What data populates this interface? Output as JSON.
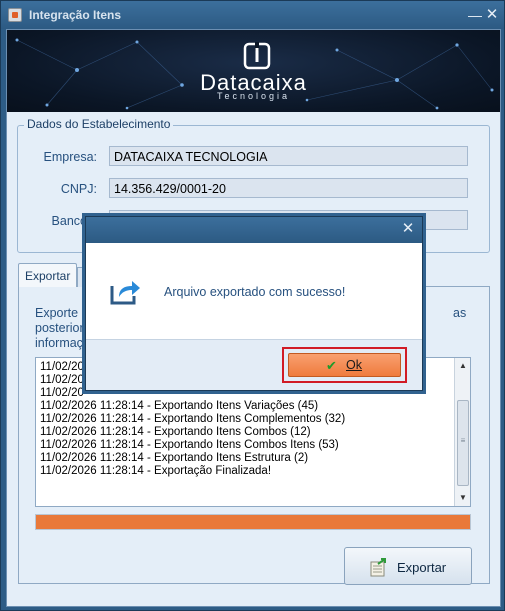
{
  "window": {
    "title": "Integração Itens",
    "minimize": "—",
    "close": "✕"
  },
  "banner": {
    "brand": "Datacaixa",
    "tagline": "Tecnologia"
  },
  "establishment": {
    "group_title": "Dados do Estabelecimento",
    "empresa_label": "Empresa:",
    "empresa_value": "DATACAIXA TECNOLOGIA",
    "cnpj_label": "CNPJ:",
    "cnpj_value": "14.356.429/0001-20",
    "banco_label": "Banco",
    "banco_value": ""
  },
  "tabs": [
    {
      "label": "Exportar"
    }
  ],
  "export": {
    "desc_line1": "Exporte o",
    "desc_line1_end": "as",
    "desc_line2": "posterior",
    "desc_line3": "informaç",
    "log_lines": [
      "11/02/20",
      "11/02/20",
      "11/02/20",
      "11/02/2026 11:28:14 - Exportando Itens Variações (45)",
      "11/02/2026 11:28:14 - Exportando Itens Complementos (32)",
      "11/02/2026 11:28:14 - Exportando Itens Combos (12)",
      "11/02/2026 11:28:14 - Exportando Itens Combos Itens (53)",
      "11/02/2026 11:28:14 - Exportando Itens Estrutura (2)",
      "11/02/2026 11:28:14 - Exportação Finalizada!"
    ],
    "progress_fraction": 1.0,
    "progress_color": "#e9793a",
    "export_button": "Exportar"
  },
  "dialog": {
    "close": "✕",
    "message": "Arquivo exportado com sucesso!",
    "ok_label": "Ok",
    "icon": "share-export-icon",
    "focus_color": "#d11b25"
  }
}
